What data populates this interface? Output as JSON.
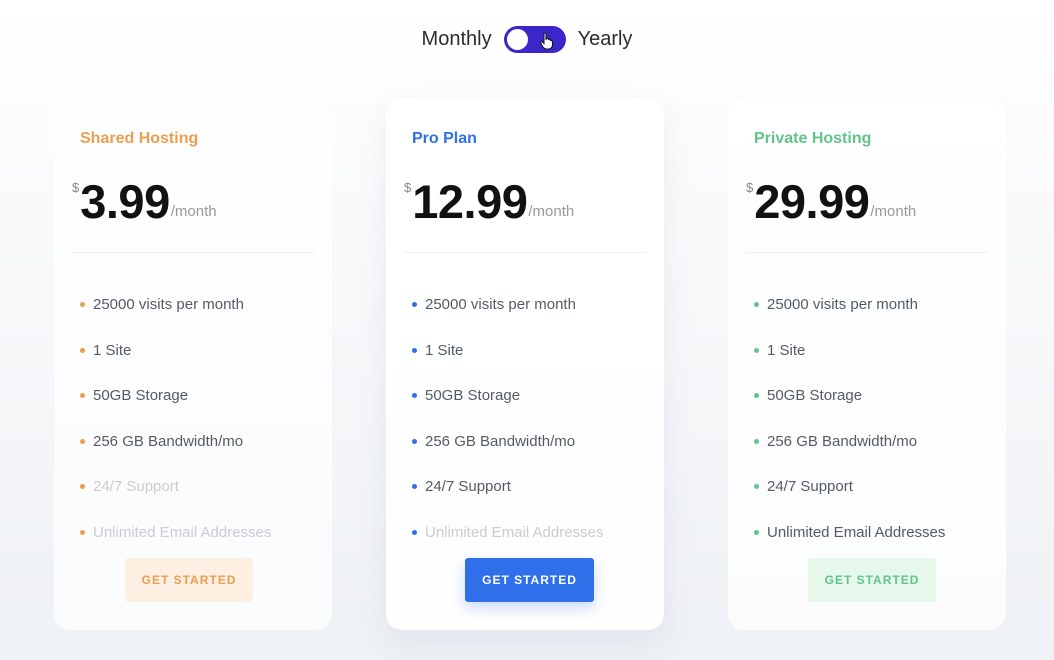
{
  "billing": {
    "monthly_label": "Monthly",
    "yearly_label": "Yearly",
    "toggle_state": "monthly"
  },
  "colors": {
    "toggle": "#3a26c9",
    "shared": "#eb9f4e",
    "pro": "#2f6fe9",
    "private": "#62c48a"
  },
  "plans": [
    {
      "name": "Shared Hosting",
      "currency": "$",
      "price": "3.99",
      "period": "/month",
      "color": "#eb9f4e",
      "cta": "GET STARTED",
      "features": [
        {
          "text": "25000 visits per month",
          "enabled": true
        },
        {
          "text": "1 Site",
          "enabled": true
        },
        {
          "text": "50GB Storage",
          "enabled": true
        },
        {
          "text": "256 GB Bandwidth/mo",
          "enabled": true
        },
        {
          "text": "24/7 Support",
          "enabled": false
        },
        {
          "text": "Unlimited Email Addresses",
          "enabled": false
        }
      ]
    },
    {
      "name": "Pro Plan",
      "currency": "$",
      "price": "12.99",
      "period": "/month",
      "color": "#2f6fe9",
      "cta": "GET STARTED",
      "features": [
        {
          "text": "25000 visits per month",
          "enabled": true
        },
        {
          "text": "1 Site",
          "enabled": true
        },
        {
          "text": "50GB Storage",
          "enabled": true
        },
        {
          "text": "256 GB Bandwidth/mo",
          "enabled": true
        },
        {
          "text": "24/7 Support",
          "enabled": true
        },
        {
          "text": "Unlimited Email Addresses",
          "enabled": false
        }
      ]
    },
    {
      "name": "Private Hosting",
      "currency": "$",
      "price": "29.99",
      "period": "/month",
      "color": "#62c48a",
      "cta": "GET STARTED",
      "features": [
        {
          "text": "25000 visits per month",
          "enabled": true
        },
        {
          "text": "1 Site",
          "enabled": true
        },
        {
          "text": "50GB Storage",
          "enabled": true
        },
        {
          "text": "256 GB Bandwidth/mo",
          "enabled": true
        },
        {
          "text": "24/7 Support",
          "enabled": true
        },
        {
          "text": "Unlimited Email Addresses",
          "enabled": true
        }
      ]
    }
  ]
}
